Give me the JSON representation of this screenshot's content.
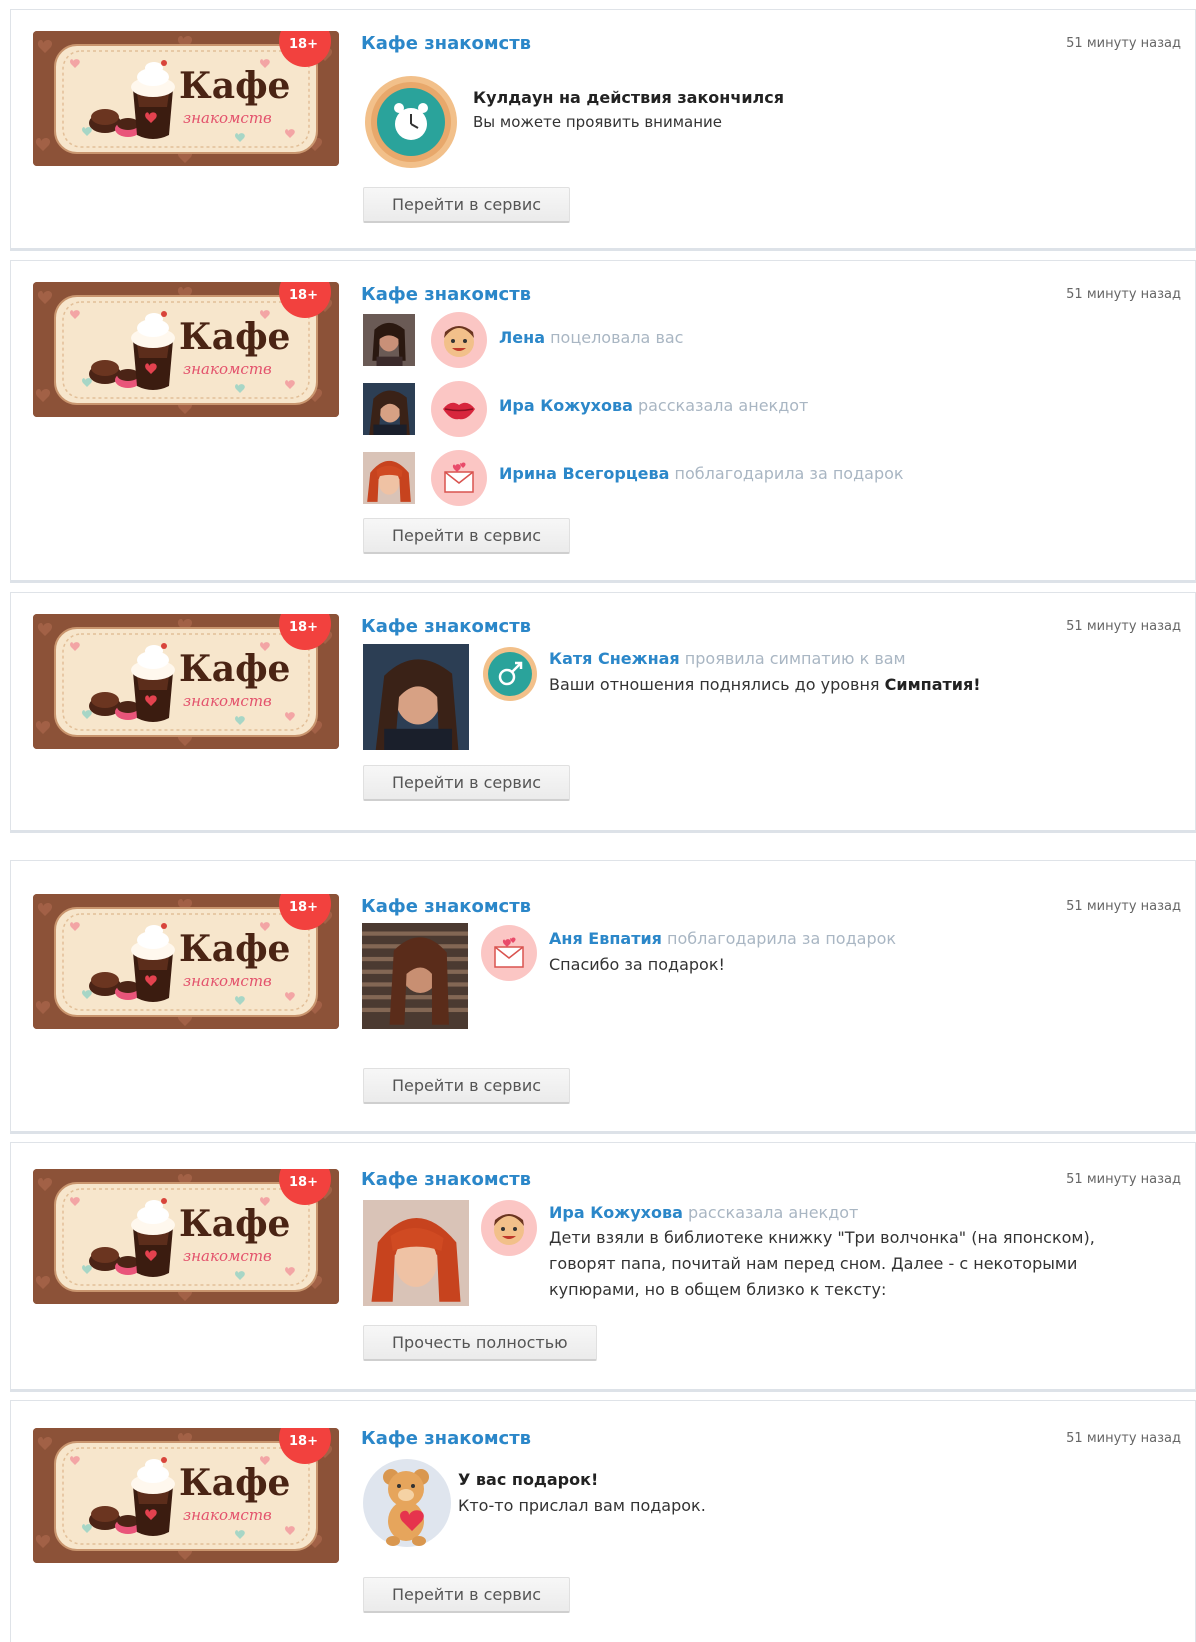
{
  "app": {
    "name": "Кафе знакомств",
    "banner_title": "Кафе",
    "banner_sub": "знакомств",
    "age_badge": "18+",
    "time": "51 минуту назад"
  },
  "colors": {
    "link": "#2b87c9",
    "muted": "#a9b6c3",
    "badge": "#f2413e",
    "pink_icon_bg": "#fbc6c4"
  },
  "cards": [
    {
      "icon": "alarm-clock-icon",
      "heading": "Кулдаун на действия закончился",
      "text": "Вы можете проявить внимание",
      "button": "Перейти в сервис"
    },
    {
      "events": [
        {
          "name": "Лена",
          "action": "поцеловала вас",
          "icon": "smiling-man-icon"
        },
        {
          "name": "Ира Кожухова",
          "action": "рассказала анекдот",
          "icon": "lips-icon"
        },
        {
          "name": "Ирина Всегорцева",
          "action": "поблагодарила за подарок",
          "icon": "heart-envelope-icon"
        }
      ],
      "button": "Перейти в сервис"
    },
    {
      "icon": "gender-symbol-icon",
      "name": "Катя Снежная",
      "action": "проявила симпатию к вам",
      "text_prefix": "Ваши отношения поднялись до уровня",
      "text_strong": "Симпатия!",
      "button": "Перейти в сервис"
    },
    {
      "icon": "heart-envelope-icon",
      "name": "Аня Евпатия",
      "action": "поблагодарила за подарок",
      "text": "Спасибо за подарок!",
      "button": "Перейти в сервис"
    },
    {
      "icon": "smiling-man-icon",
      "name": "Ира Кожухова",
      "action": "рассказала анекдот",
      "text": "Дети взяли в библиотеке книжку \"Три волчонка\" (на японском), говорят папа, почитай нам перед сном. Далее - с некоторыми купюрами, но в общем близко к тексту:",
      "button": "Прочесть полностью"
    },
    {
      "icon": "teddy-bear-icon",
      "heading": "У вас подарок!",
      "text": "Кто-то прислал вам подарок.",
      "button": "Перейти в сервис"
    }
  ]
}
